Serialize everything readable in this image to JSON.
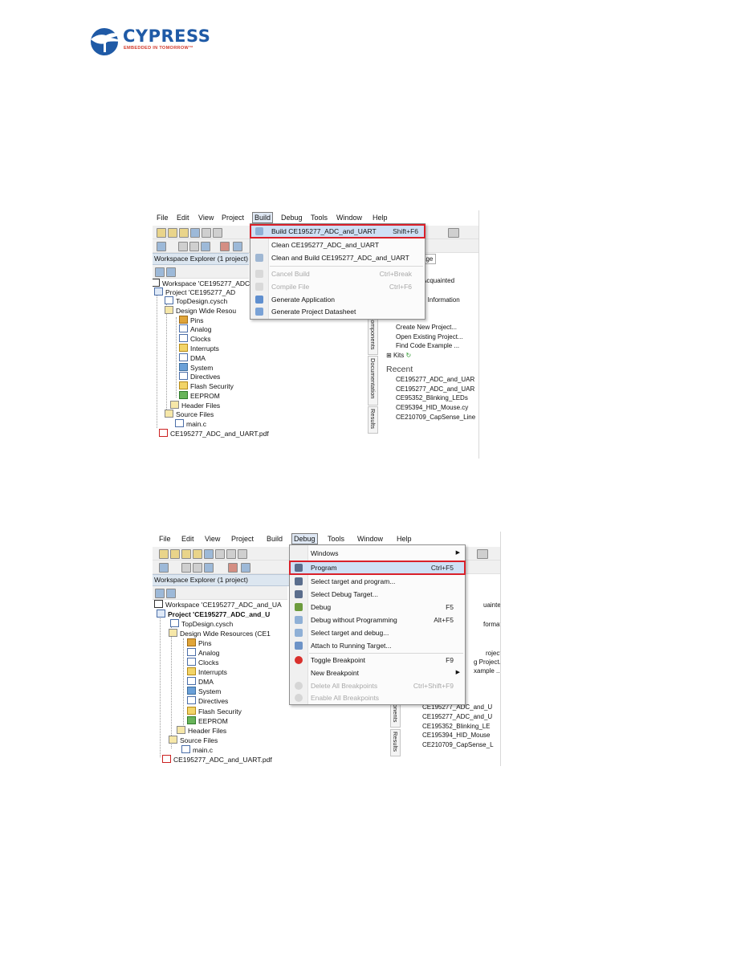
{
  "logo": {
    "brand": "CYPRESS",
    "tagline": "EMBEDDED IN TOMORROW™",
    "icon": "cypress-tree-logo"
  },
  "colors": {
    "brand_blue": "#1f5aa6",
    "brand_red": "#d33b2c",
    "highlight_border": "#d9202a",
    "menu_hover": "#cfe0f5"
  },
  "screenshot1": {
    "menubar": [
      "File",
      "Edit",
      "View",
      "Project",
      "Build",
      "Debug",
      "Tools",
      "Window",
      "Help"
    ],
    "active_menu": "Build",
    "workspace_header": "Workspace Explorer (1 project)",
    "tree": [
      "Workspace 'CE195277_ADC",
      "Project 'CE195277_AD",
      "TopDesign.cysch",
      "Design Wide Resou",
      "Pins",
      "Analog",
      "Clocks",
      "Interrupts",
      "DMA",
      "System",
      "Directives",
      "Flash Security",
      "EEPROM",
      "Header Files",
      "Source Files",
      "main.c",
      "CE195277_ADC_and_UART.pdf"
    ],
    "side_tabs": [
      "Components",
      "Documentation",
      "Results"
    ],
    "start_page": {
      "tab_fragment": "age",
      "top_items": [
        "Acquainted",
        "s",
        "d Information"
      ],
      "start_heading": "Start",
      "start_items": [
        "Create New Project...",
        "Open Existing Project...",
        "Find Code Example ...",
        "Kits"
      ],
      "recent_heading": "Recent",
      "recent_items": [
        "CE195277_ADC_and_UAR",
        "CE195277_ADC_and_UAR",
        "CE95352_Blinking_LEDs",
        "CE95394_HID_Mouse.cy",
        "CE210709_CapSense_Line"
      ]
    },
    "menu": {
      "items": [
        {
          "label": "Build CE195277_ADC_and_UART",
          "shortcut": "Shift+F6",
          "icon": "build-icon",
          "highlighted": true,
          "disabled": false
        },
        {
          "label": "Clean CE195277_ADC_and_UART",
          "shortcut": "",
          "icon": "",
          "highlighted": false,
          "disabled": false
        },
        {
          "label": "Clean and Build CE195277_ADC_and_UART",
          "shortcut": "",
          "icon": "clean-build-icon",
          "highlighted": false,
          "disabled": false
        },
        {
          "label": "Cancel Build",
          "shortcut": "Ctrl+Break",
          "icon": "cancel-build-icon",
          "highlighted": false,
          "disabled": true
        },
        {
          "label": "Compile File",
          "shortcut": "Ctrl+F6",
          "icon": "compile-icon",
          "highlighted": false,
          "disabled": true
        },
        {
          "label": "Generate Application",
          "shortcut": "",
          "icon": "generate-app-icon",
          "highlighted": false,
          "disabled": false
        },
        {
          "label": "Generate Project Datasheet",
          "shortcut": "",
          "icon": "datasheet-icon",
          "highlighted": false,
          "disabled": false
        }
      ]
    }
  },
  "screenshot2": {
    "menubar": [
      "File",
      "Edit",
      "View",
      "Project",
      "Build",
      "Debug",
      "Tools",
      "Window",
      "Help"
    ],
    "active_menu": "Debug",
    "workspace_header": "Workspace Explorer (1 project)",
    "tree": [
      "Workspace 'CE195277_ADC_and_UA",
      "Project 'CE195277_ADC_and_U",
      "TopDesign.cysch",
      "Design Wide Resources (CE1",
      "Pins",
      "Analog",
      "Clocks",
      "Interrupts",
      "DMA",
      "System",
      "Directives",
      "Flash Security",
      "EEPROM",
      "Header Files",
      "Source Files",
      "main.c",
      "CE195277_ADC_and_UART.pdf"
    ],
    "side_tabs": [
      "onents",
      "Results"
    ],
    "start_page": {
      "fragments": [
        "uainted",
        "formation",
        "roject...",
        "g Project...",
        "xample ..."
      ],
      "recent_items": [
        "CE195277_ADC_and_U",
        "CE195277_ADC_and_U",
        "CE195352_Blinking_LE",
        "CE195394_HID_Mouse",
        "CE210709_CapSense_L"
      ]
    },
    "menu": {
      "items": [
        {
          "label": "Windows",
          "shortcut": "",
          "icon": "",
          "submenu": true,
          "highlighted": false,
          "disabled": false
        },
        {
          "label": "Program",
          "shortcut": "Ctrl+F5",
          "icon": "program-icon",
          "submenu": false,
          "highlighted": true,
          "disabled": false
        },
        {
          "label": "Select target and program...",
          "shortcut": "",
          "icon": "select-program-icon",
          "submenu": false,
          "highlighted": false,
          "disabled": false
        },
        {
          "label": "Select Debug Target...",
          "shortcut": "",
          "icon": "debug-target-icon",
          "submenu": false,
          "highlighted": false,
          "disabled": false
        },
        {
          "label": "Debug",
          "shortcut": "F5",
          "icon": "debug-icon",
          "submenu": false,
          "highlighted": false,
          "disabled": false
        },
        {
          "label": "Debug without Programming",
          "shortcut": "Alt+F5",
          "icon": "debug-noprog-icon",
          "submenu": false,
          "highlighted": false,
          "disabled": false
        },
        {
          "label": "Select target and debug...",
          "shortcut": "",
          "icon": "select-debug-icon",
          "submenu": false,
          "highlighted": false,
          "disabled": false
        },
        {
          "label": "Attach to Running Target...",
          "shortcut": "",
          "icon": "attach-icon",
          "submenu": false,
          "highlighted": false,
          "disabled": false
        },
        {
          "label": "Toggle Breakpoint",
          "shortcut": "F9",
          "icon": "breakpoint-icon",
          "submenu": false,
          "highlighted": false,
          "disabled": false
        },
        {
          "label": "New Breakpoint",
          "shortcut": "",
          "icon": "",
          "submenu": true,
          "highlighted": false,
          "disabled": false
        },
        {
          "label": "Delete All Breakpoints",
          "shortcut": "Ctrl+Shift+F9",
          "icon": "delete-breakpoints-icon",
          "submenu": false,
          "highlighted": false,
          "disabled": true
        },
        {
          "label": "Enable All Breakpoints",
          "shortcut": "",
          "icon": "enable-breakpoints-icon",
          "submenu": false,
          "highlighted": false,
          "disabled": true
        }
      ]
    }
  }
}
